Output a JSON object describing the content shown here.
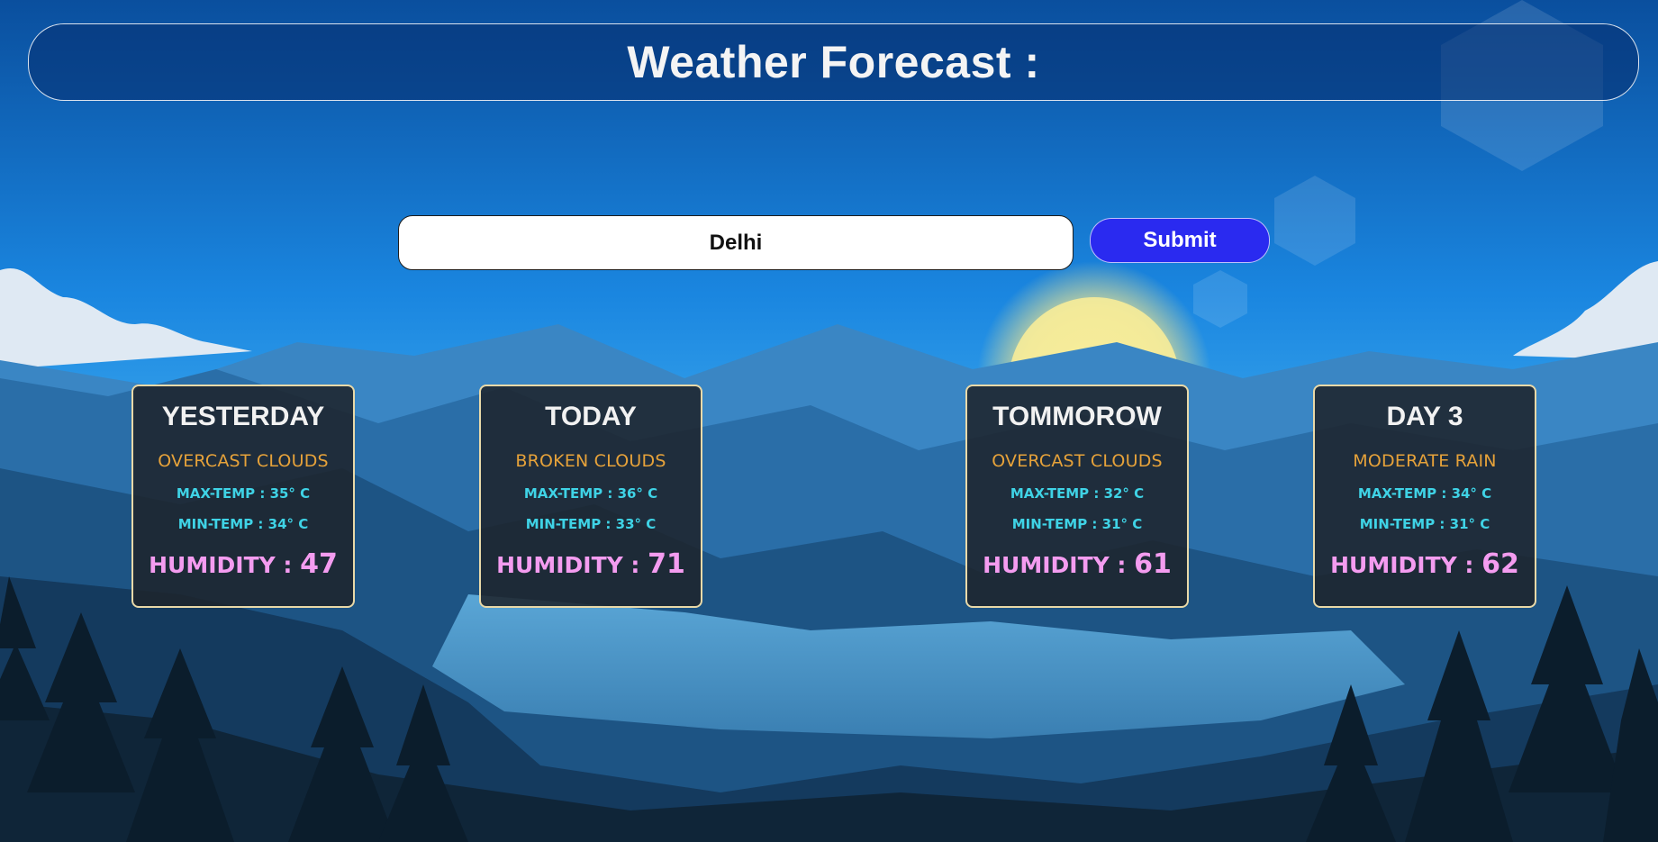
{
  "header": {
    "title": "Weather Forecast :"
  },
  "search": {
    "value": "Delhi",
    "submit_label": "Submit"
  },
  "labels": {
    "max_temp": "MAX-TEMP : ",
    "min_temp": "MIN-TEMP : ",
    "humidity": "HUMIDITY : "
  },
  "cards": [
    {
      "day": "YESTERDAY",
      "condition": "OVERCAST CLOUDS",
      "max_temp": "35° C",
      "min_temp": "34° C",
      "humidity": "47"
    },
    {
      "day": "TODAY",
      "condition": "BROKEN CLOUDS",
      "max_temp": "36° C",
      "min_temp": "33° C",
      "humidity": "71"
    },
    {
      "day": "TOMMOROW",
      "condition": "OVERCAST CLOUDS",
      "max_temp": "32° C",
      "min_temp": "31° C",
      "humidity": "61"
    },
    {
      "day": "DAY 3",
      "condition": "MODERATE RAIN",
      "max_temp": "34° C",
      "min_temp": "31° C",
      "humidity": "62"
    }
  ],
  "colors": {
    "condition": "#e6a23a",
    "temp": "#3fd3e6",
    "humidity": "#f49cf0",
    "submit": "#2a2af0"
  }
}
